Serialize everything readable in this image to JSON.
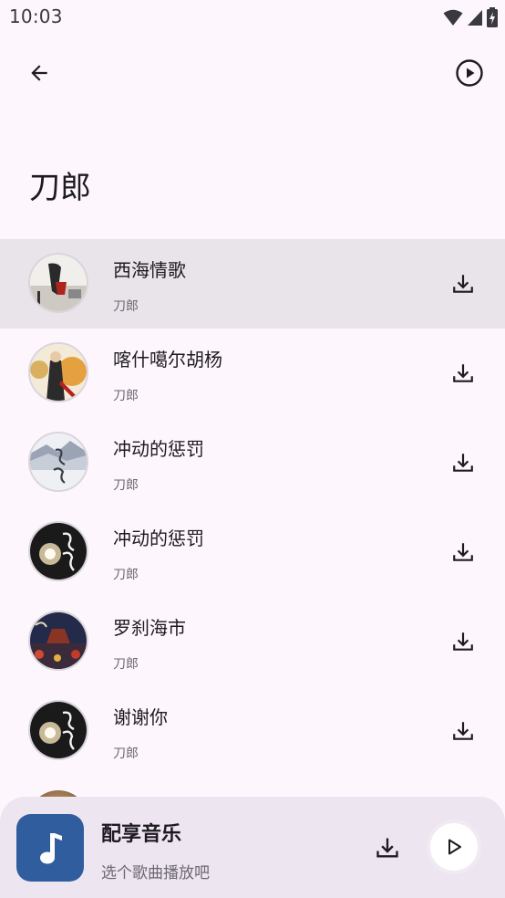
{
  "status_bar": {
    "time": "10:03"
  },
  "header": {
    "title": "刀郎"
  },
  "songs": [
    {
      "title": "西海情歌",
      "artist": "刀郎",
      "selected": true,
      "cover": "cover-xihai"
    },
    {
      "title": "喀什噶尔胡杨",
      "artist": "刀郎",
      "selected": false,
      "cover": "cover-kashi"
    },
    {
      "title": "冲动的惩罚",
      "artist": "刀郎",
      "selected": false,
      "cover": "cover-chongdong-white"
    },
    {
      "title": "冲动的惩罚",
      "artist": "刀郎",
      "selected": false,
      "cover": "cover-chongdong-black"
    },
    {
      "title": "罗刹海市",
      "artist": "刀郎",
      "selected": false,
      "cover": "cover-luosha"
    },
    {
      "title": "谢谢你",
      "artist": "刀郎",
      "selected": false,
      "cover": "cover-xiexie"
    }
  ],
  "mini_player": {
    "title": "配享音乐",
    "subtitle": "选个歌曲播放吧"
  },
  "colors": {
    "background": "#fdf7fd",
    "selected_row": "#e8e4ea",
    "mini_player_bg": "#ede5ef",
    "accent": "#2f5d9e"
  },
  "icons": {
    "back": "arrow-left-icon",
    "play_all": "play-circle-icon",
    "download": "download-icon",
    "note": "music-note-icon",
    "play": "play-icon"
  }
}
